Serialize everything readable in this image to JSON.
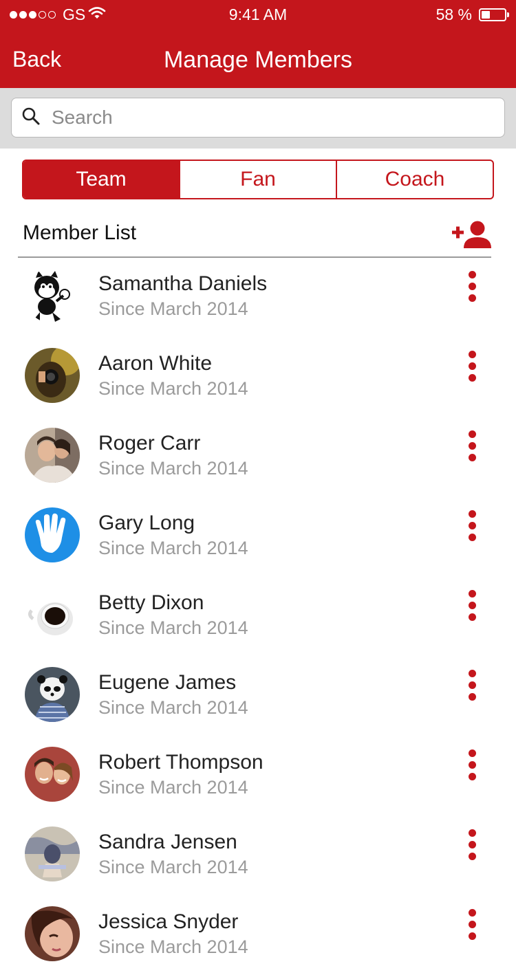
{
  "status_bar": {
    "carrier": "GS",
    "time": "9:41 AM",
    "battery": "58 %",
    "signal_icon": "signal-dots-icon",
    "wifi_icon": "wifi-icon",
    "battery_icon": "battery-icon"
  },
  "nav": {
    "back_label": "Back",
    "title": "Manage Members"
  },
  "search": {
    "placeholder": "Search",
    "icon": "search-icon"
  },
  "tabs": [
    {
      "label": "Team",
      "active": true
    },
    {
      "label": "Fan",
      "active": false
    },
    {
      "label": "Coach",
      "active": false
    }
  ],
  "member_list": {
    "header": "Member List",
    "add_icon": "add-person-icon",
    "items": [
      {
        "name": "Samantha Daniels",
        "since": "Since March 2014"
      },
      {
        "name": "Aaron White",
        "since": "Since March 2014"
      },
      {
        "name": "Roger Carr",
        "since": "Since March 2014"
      },
      {
        "name": "Gary Long",
        "since": "Since March 2014"
      },
      {
        "name": "Betty Dixon",
        "since": "Since March 2014"
      },
      {
        "name": "Eugene James",
        "since": "Since March 2014"
      },
      {
        "name": "Robert Thompson",
        "since": "Since March 2014"
      },
      {
        "name": "Sandra Jensen",
        "since": "Since March 2014"
      },
      {
        "name": "Jessica Snyder",
        "since": "Since March 2014"
      }
    ]
  },
  "colors": {
    "accent": "#c4161c",
    "search_bg": "#dcdcdc",
    "subtext": "#9b9b9b"
  }
}
